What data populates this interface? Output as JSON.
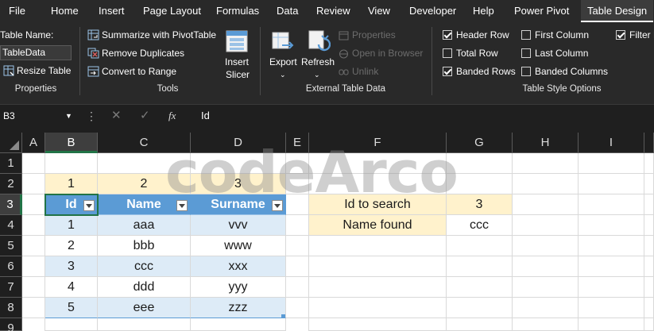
{
  "ribbon": {
    "tabs": [
      {
        "label": "File",
        "active": false
      },
      {
        "label": "Home",
        "active": false
      },
      {
        "label": "Insert",
        "active": false
      },
      {
        "label": "Page Layout",
        "active": false
      },
      {
        "label": "Formulas",
        "active": false
      },
      {
        "label": "Data",
        "active": false
      },
      {
        "label": "Review",
        "active": false
      },
      {
        "label": "View",
        "active": false
      },
      {
        "label": "Developer",
        "active": false
      },
      {
        "label": "Help",
        "active": false
      },
      {
        "label": "Power Pivot",
        "active": false
      },
      {
        "label": "Table Design",
        "active": true
      }
    ],
    "properties": {
      "table_name_label": "Table Name:",
      "table_name_value": "TableData",
      "resize_table": "Resize Table",
      "group_label": "Properties"
    },
    "tools": {
      "summarize": "Summarize with PivotTable",
      "remove_duplicates": "Remove Duplicates",
      "convert_to_range": "Convert to Range",
      "insert_slicer_line1": "Insert",
      "insert_slicer_line2": "Slicer",
      "group_label": "Tools"
    },
    "external": {
      "export": "Export",
      "refresh": "Refresh",
      "properties": "Properties",
      "open_in_browser": "Open in Browser",
      "unlink": "Unlink",
      "group_label": "External Table Data"
    },
    "style_options": {
      "header_row": {
        "label": "Header Row",
        "checked": true
      },
      "total_row": {
        "label": "Total Row",
        "checked": false
      },
      "banded_rows": {
        "label": "Banded Rows",
        "checked": true
      },
      "first_column": {
        "label": "First Column",
        "checked": false
      },
      "last_column": {
        "label": "Last Column",
        "checked": false
      },
      "banded_columns": {
        "label": "Banded Columns",
        "checked": false
      },
      "filter_button": {
        "label": "Filter Bu",
        "checked": true
      },
      "group_label": "Table Style Options"
    },
    "colors": {
      "background": "#292929",
      "text": "#ffffff"
    }
  },
  "formula_bar": {
    "name_box": "B3",
    "fx_label": "fx",
    "cancel_symbol": "✕",
    "enter_symbol": "✓",
    "value": "Id"
  },
  "sheet": {
    "columns": [
      "A",
      "B",
      "C",
      "D",
      "E",
      "F",
      "G",
      "H",
      "I"
    ],
    "rows": [
      "1",
      "2",
      "3",
      "4",
      "5",
      "6",
      "7",
      "8",
      "9"
    ],
    "selected_cell": "B3",
    "row2_values": [
      "1",
      "2",
      "3"
    ],
    "table": {
      "headers": [
        "Id",
        "Name",
        "Surname"
      ],
      "rows": [
        [
          "1",
          "aaa",
          "vvv"
        ],
        [
          "2",
          "bbb",
          "www"
        ],
        [
          "3",
          "ccc",
          "xxx"
        ],
        [
          "4",
          "ddd",
          "yyy"
        ],
        [
          "5",
          "eee",
          "zzz"
        ]
      ],
      "header_color": "#5b9bd5",
      "band_color": "#ddebf7"
    },
    "lookup": {
      "search_label": "Id to search",
      "search_value": "3",
      "found_label": "Name found",
      "found_value": "ccc",
      "highlight_color": "#fff2cc"
    }
  },
  "watermark": "codeArco"
}
